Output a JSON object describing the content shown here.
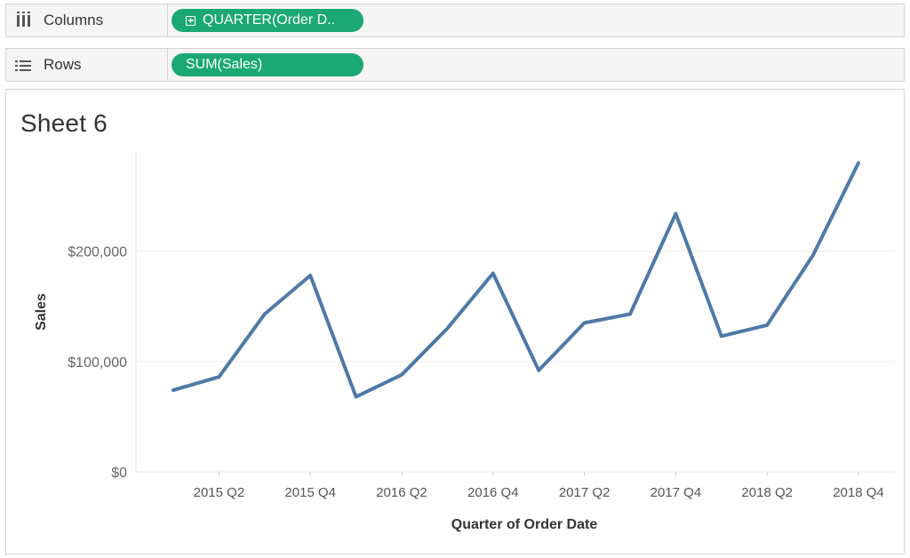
{
  "shelves": {
    "columns": {
      "label": "Columns",
      "pill": "QUARTER(Order D.."
    },
    "rows": {
      "label": "Rows",
      "pill": "SUM(Sales)"
    }
  },
  "colors": {
    "pill": "#1aa874",
    "line": "#4e79a7",
    "grid": "#eeeeee"
  },
  "sheet": {
    "title": "Sheet 6"
  },
  "chart_data": {
    "type": "line",
    "title": "Sheet 6",
    "xlabel": "Quarter of Order Date",
    "ylabel": "Sales",
    "x": [
      "2015 Q1",
      "2015 Q2",
      "2015 Q3",
      "2015 Q4",
      "2016 Q1",
      "2016 Q2",
      "2016 Q3",
      "2016 Q4",
      "2017 Q1",
      "2017 Q2",
      "2017 Q3",
      "2017 Q4",
      "2018 Q1",
      "2018 Q2",
      "2018 Q3",
      "2018 Q4"
    ],
    "x_tick_labels": [
      "2015 Q2",
      "2015 Q4",
      "2016 Q2",
      "2016 Q4",
      "2017 Q2",
      "2017 Q4",
      "2018 Q2",
      "2018 Q4"
    ],
    "series": [
      {
        "values": [
          74000,
          86000,
          143000,
          178000,
          68000,
          88000,
          130000,
          180000,
          92000,
          135000,
          143000,
          234000,
          123000,
          133000,
          196000,
          280000
        ]
      }
    ],
    "y_ticks": [
      0,
      100000,
      200000
    ],
    "y_tick_labels": [
      "$0",
      "$100,000",
      "$200,000"
    ],
    "ylim": [
      0,
      290000
    ],
    "grid": "horizontal",
    "legend": "none"
  }
}
